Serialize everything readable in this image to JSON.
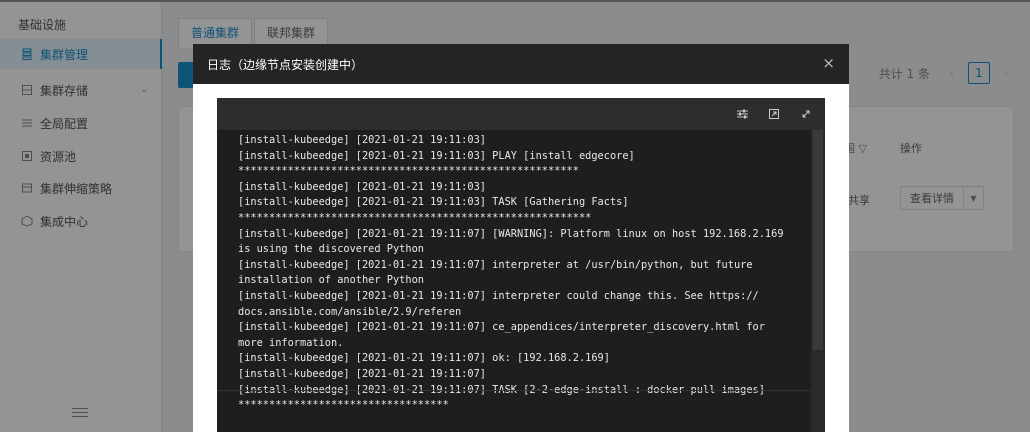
{
  "sidebar": {
    "section_title": "基础设施",
    "items": [
      {
        "label": "集群管理",
        "icon": "cluster-icon",
        "active": true
      },
      {
        "label": "集群存储",
        "icon": "storage-icon",
        "has_children": true
      },
      {
        "label": "全局配置",
        "icon": "config-icon"
      },
      {
        "label": "资源池",
        "icon": "resource-pool-icon"
      },
      {
        "label": "集群伸缩策略",
        "icon": "scaling-icon"
      },
      {
        "label": "集成中心",
        "icon": "integration-icon"
      }
    ]
  },
  "tabs": [
    "普通集群",
    "联邦集群"
  ],
  "pagination": {
    "total": "共计 1 条",
    "current_page": "1"
  },
  "table": {
    "headers": {
      "scope": "围",
      "operation": "操作"
    },
    "row": {
      "scope_value": "共享",
      "action": "查看详情"
    }
  },
  "dialog": {
    "title": "日志（边缘节点安装创建中）",
    "close_symbol": "×",
    "log_lines": [
      "[install-kubeedge] [2021-01-21 19:11:03]",
      "[install-kubeedge] [2021-01-21 19:11:03] PLAY [install edgecore]",
      "*******************************************************",
      "[install-kubeedge] [2021-01-21 19:11:03]",
      "[install-kubeedge] [2021-01-21 19:11:03] TASK [Gathering Facts]",
      "*********************************************************",
      "[install-kubeedge] [2021-01-21 19:11:07] [WARNING]: Platform linux on host 192.168.2.169",
      "is using the discovered Python",
      "[install-kubeedge] [2021-01-21 19:11:07] interpreter at /usr/bin/python, but future",
      "installation of another Python",
      "[install-kubeedge] [2021-01-21 19:11:07] interpreter could change this. See https://",
      "docs.ansible.com/ansible/2.9/referen",
      "[install-kubeedge] [2021-01-21 19:11:07] ce_appendices/interpreter_discovery.html for",
      "more information.",
      "[install-kubeedge] [2021-01-21 19:11:07] ok: [192.168.2.169]",
      "[install-kubeedge] [2021-01-21 19:11:07]",
      "[install-kubeedge] [2021-01-21 19:11:07] TASK [2-2-edge-install : docker pull images]",
      "**********************************"
    ]
  },
  "colors": {
    "accent": "#1a8fd0",
    "editor_bg": "#1e1e1e",
    "dialog_header": "#242424"
  }
}
